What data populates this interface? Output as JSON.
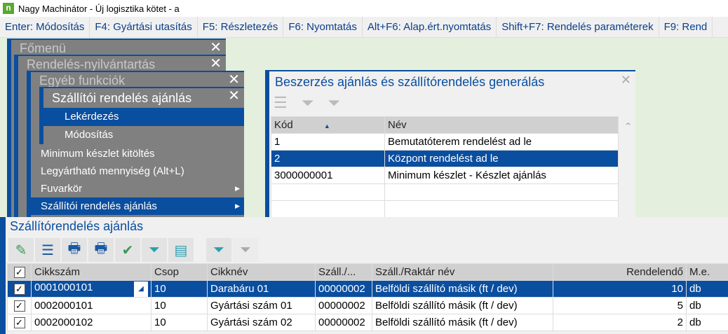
{
  "window": {
    "title": "Nagy Machinátor - Új logisztika kötet - a",
    "logo": "n"
  },
  "fkeys": [
    "Enter: Módosítás",
    "F4: Gyártási utasítás",
    "F5: Részletezés",
    "F6: Nyomtatás",
    "Alt+F6: Alap.ért.nyomtatás",
    "Shift+F7: Rendelés paraméterek",
    "F9: Rend"
  ],
  "menus": {
    "main": "Főmenü",
    "orders": "Rendelés-nyilvántartás",
    "other": "Egyéb funkciók",
    "supplier": "Szállítói rendelés ajánlás",
    "supplier_items": [
      "Lekérdezés",
      "Módosítás"
    ],
    "other_items": [
      "Minimum készlet kitöltés",
      "Legyártható mennyiség (Alt+L)",
      "Fuvarkör",
      "Szállítói rendelés ajánlás"
    ]
  },
  "dialog": {
    "title": "Beszerzés ajánlás és szállítórendelés generálás",
    "columns": [
      "Kód",
      "Név"
    ],
    "rows": [
      [
        "1",
        "Bemutatóterem rendelést ad le"
      ],
      [
        "2",
        "Központ rendelést ad le"
      ],
      [
        "3000000001",
        "Minimum készlet - Készlet ajánlás"
      ]
    ]
  },
  "grid": {
    "title": "Szállítórendelés ajánlás",
    "columns": [
      "Cikkszám",
      "Csop",
      "Cikknév",
      "Száll./...",
      "Száll./Raktár név",
      "Rendelendő",
      "M.e."
    ],
    "rows": [
      [
        "0001000101",
        "10",
        "Darabáru 01",
        "00000002",
        "Belföldi szállító másik (ft / dev)",
        "10",
        "db"
      ],
      [
        "0002000101",
        "10",
        "Gyártási szám 01",
        "00000002",
        "Belföldi szállító másik (ft / dev)",
        "5",
        "db"
      ],
      [
        "0002000102",
        "10",
        "Gyártási szám 02",
        "00000002",
        "Belföldi szállító másik (ft / dev)",
        "2",
        "db"
      ]
    ]
  },
  "colors": {
    "accent": "#0a4ea0",
    "menu_bg": "#808080",
    "background": "#e4f0dd"
  }
}
